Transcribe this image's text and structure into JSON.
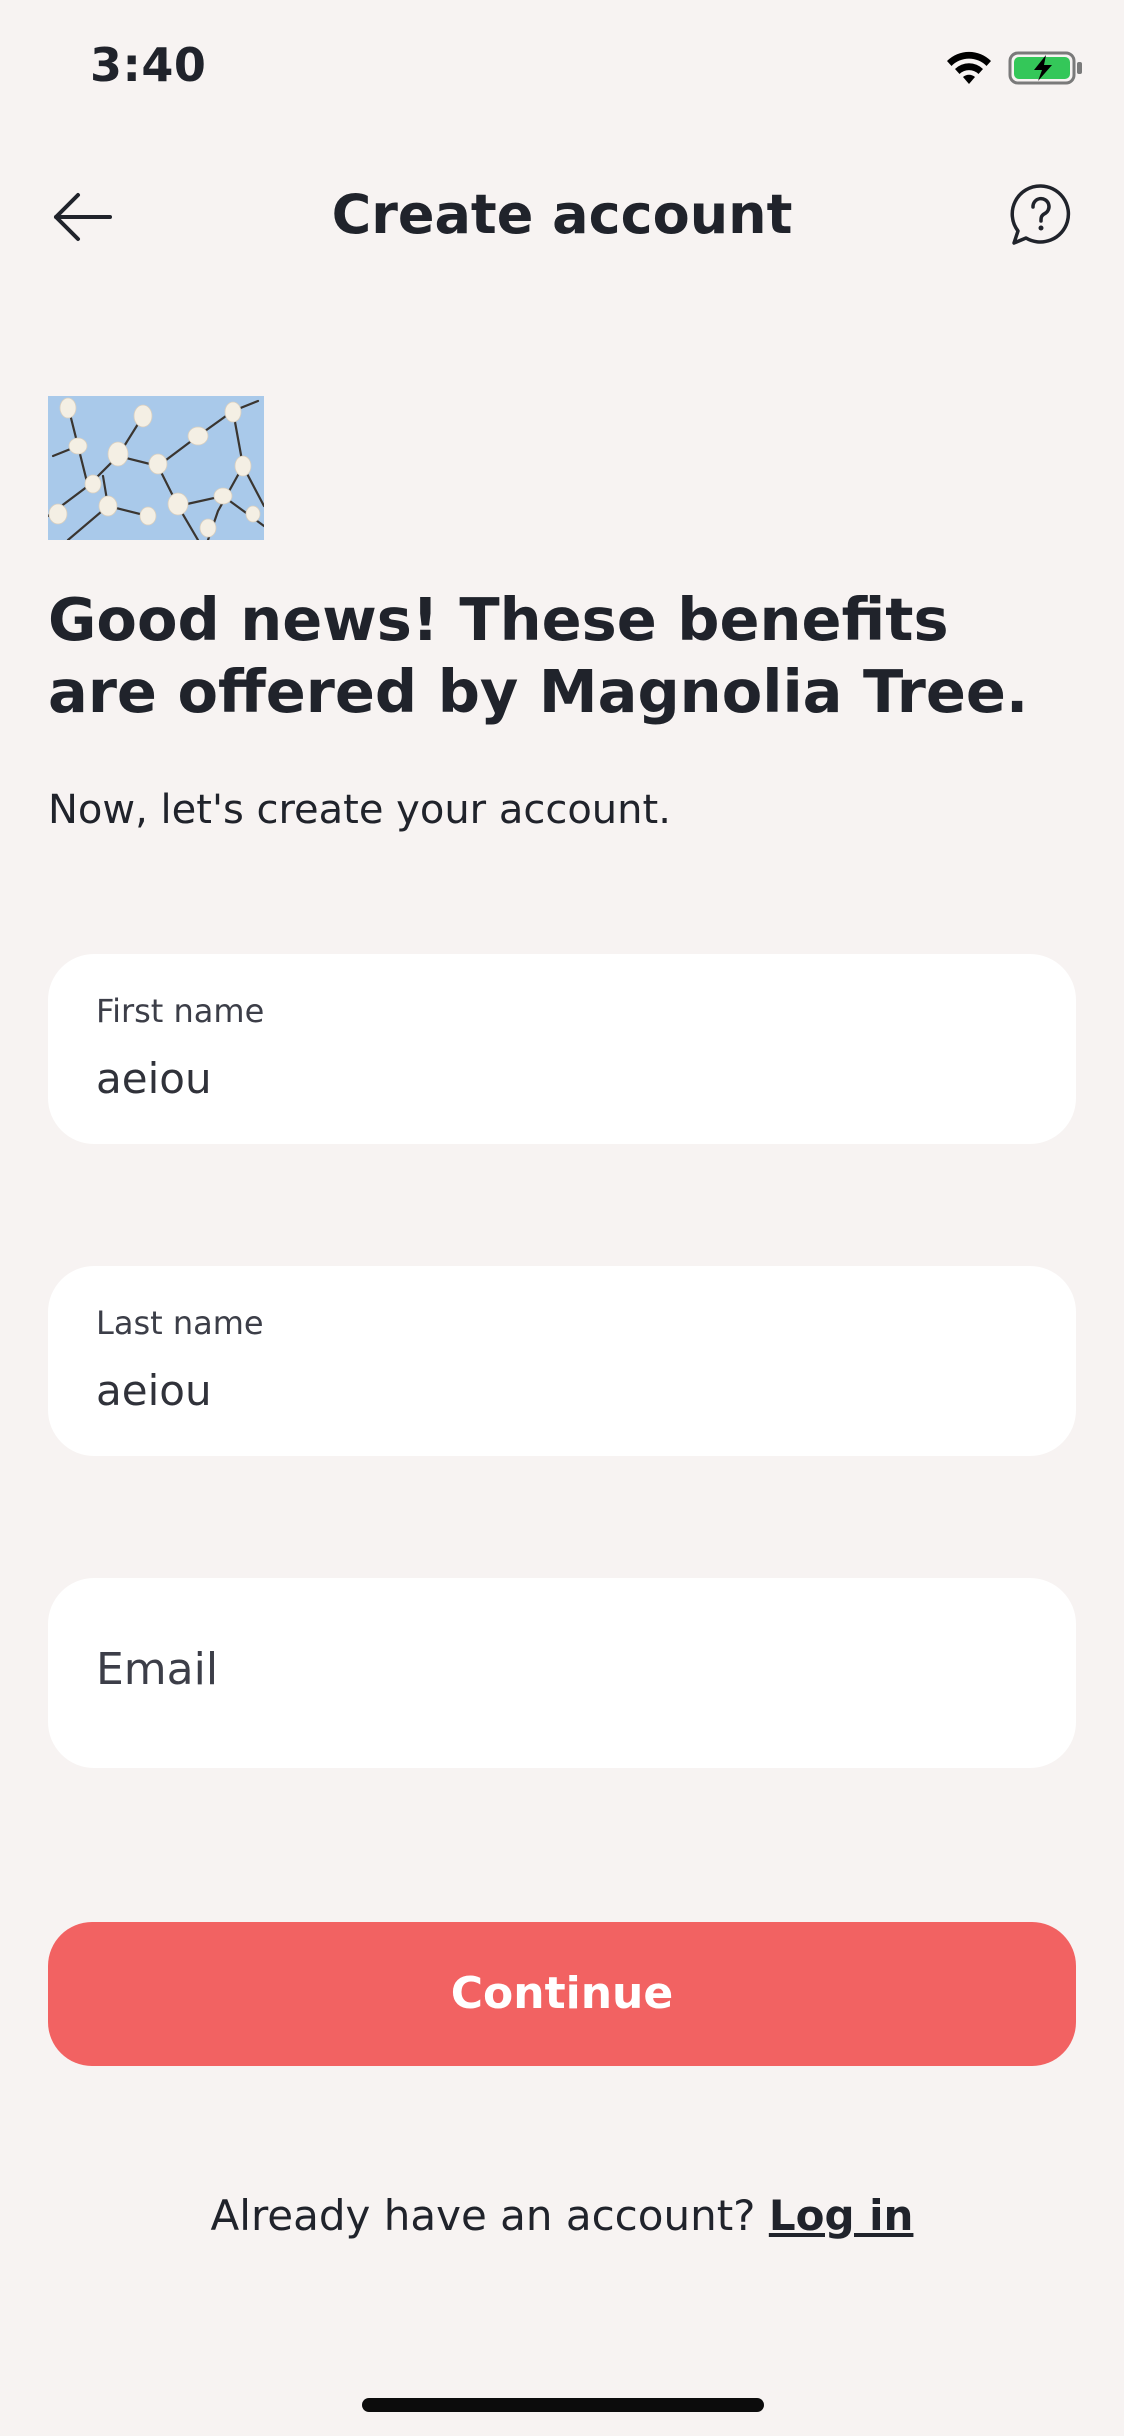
{
  "status_bar": {
    "time": "3:40",
    "wifi_icon": "wifi-icon",
    "battery_icon": "battery-charging-icon",
    "battery_color": "#34c759"
  },
  "header": {
    "title": "Create account",
    "back_icon": "arrow-left-icon",
    "help_icon": "help-chat-icon"
  },
  "intro": {
    "image": "magnolia-blossoms-image",
    "headline": "Good news! These benefits are offered by Magnolia Tree.",
    "subtitle": "Now, let's create your account."
  },
  "form": {
    "first_name": {
      "label": "First name",
      "value": "aeiou"
    },
    "last_name": {
      "label": "Last name",
      "value": "aeiou"
    },
    "email": {
      "placeholder": "Email"
    }
  },
  "actions": {
    "continue_label": "Continue",
    "login_prompt": "Already have an account?",
    "login_link": "Log in",
    "accent_color": "#f26262"
  }
}
